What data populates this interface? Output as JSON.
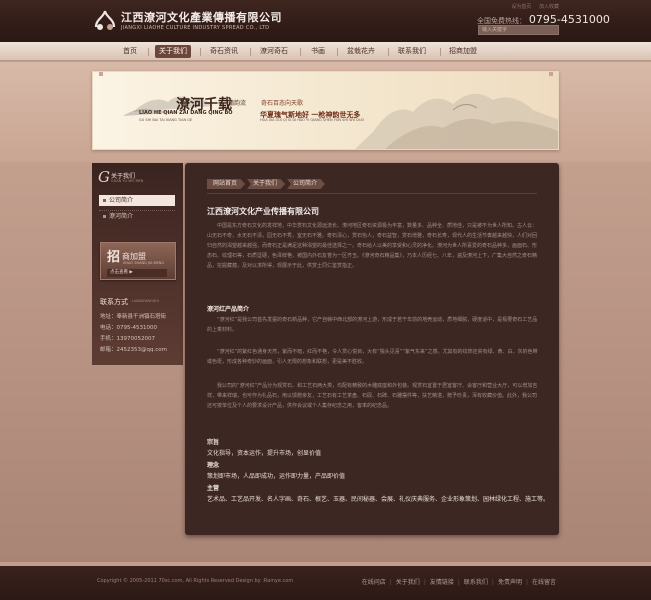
{
  "header": {
    "company_cn": "江西潦河文化產業傳播有限公司",
    "company_en": "JIANGXI LIAOHE CULTURE INDUSTRY SPREAD CO., LTD",
    "top_links": [
      "设为首页",
      "加入收藏"
    ],
    "hotline_label": "全国免费热线：",
    "hotline_number": "0795-4531000",
    "search_placeholder": "输入关键字"
  },
  "nav": {
    "items": [
      "首页",
      "关于我们",
      "奇石资讯",
      "潦河奇石",
      "书画",
      "盆栽花卉",
      "联系我们",
      "招商加盟"
    ],
    "active_index": 1
  },
  "banner": {
    "title": "潦河千载",
    "subtitle_a": "蒲韵流",
    "subtitle_b": "奇石百态向天歌",
    "pinyin_a": "LIAO HE QIAN ZAI DANG QING BO",
    "pinyin_b": "GU SHI BAI TAI XIANG TIAN GE",
    "slogan": "华夏瑰气斯地好 一枪神韵世无多",
    "pinyin_c": "HUA XIA GUI QI SI DI HAO  YI QIANG SHEN YUN SHI WU DUO"
  },
  "sidebar": {
    "head_initial": "G",
    "head_cn": "关于我们",
    "head_en": "GUAN YU WO MEN",
    "items": [
      "公司简介",
      "潦河简介"
    ],
    "active_index": 0,
    "join": {
      "big": "招",
      "rest": "商加盟",
      "en": "ZHAO SHANG JIA MENG",
      "button": "点击查看 ▶"
    },
    "contact": {
      "title": "联系方式",
      "title_en": "LIANXIFANGSHI",
      "lines": [
        "地址：奉新县千洲镇石塔街",
        "电话：0795-4531000",
        "手机：13970052007",
        "邮箱：2452353@qq.com"
      ]
    }
  },
  "content": {
    "breadcrumb": [
      "网站首页",
      "关于我们",
      "公司简介"
    ],
    "title": "江西潦河文化产业传播有限公司",
    "paragraph1": "中国是东方奇石文化的发祥地，中华赏石文化源远流长。潦河地区奇石资源极为丰富，数量多、品种全、质地佳，只是被不为世人所知。古人云：山无石不奇，水无石不清，园无石不秀，室无石不雅。奇石清心，赏石怡人，奇石益智，赏石增雅，奇石长寿，现代人的生活节奏越来越快，人们对回归自然的渴望越来越强，而奇石正是满足这种渴望的最佳选择之一。奇石给人以美的享受和心灵的净化。潦河为世人所喜爱的奇石品种多，画面石、形态石、纹理石等，石质坚硬，色泽鲜艳，被国内外石友誉为一区齐玉。《潦河奇石精品集》，乃本人历经七、八年，遍及潦河上下，广集大自然之奇石精品，挖掘藏蕴，及对以求所得，现展示于此，供赏士同仁鉴赏指正。",
    "section1_heading": "潦河红产品简介",
    "paragraph2": "“潦河红”是我公司首先发掘的奇石新品种，它产自赣中西北部的潦河上游，形成于若干年前的地壳运动，质地细腻，硬度适中，是极要奇石工艺品的上乘材料。",
    "paragraph3": "“潦河红”的紫红色通身天然，紫而不暗，红而不艳，令人赏心悦目，大有“独头见喜”“紫气东来”之感。尤其有的纹饰还夹有绿、黄、白、灰的色带或色斑，形成各种奇妙的画面，引人无限的想象和联想，更是美不胜收。",
    "paragraph4": "我公司的“潦河红”产品分为观赏石、和工艺石两大类，均配有精致的木雕底座和外包装。观赏石宜置于居室客厅、会客厅和营业大厅，可以增加吉祥，带来祥瑞，也可作为礼品石，用以馈赠亲友，工艺石有工艺茶盘、石砚、石碑、石雕摆件等，扶艺精湛，赠予珍贵，浑有收藏价值。此外，我公司还可按单位及个人的要求设计产品，供作会议或个人集存纪念之用，客率的纪念品。",
    "sections": [
      {
        "heading": "宗旨",
        "text": "文化指导，资本运作，提升市场，创显价值"
      },
      {
        "heading": "理念",
        "text": "策划即市场，人品即成功，运作即力量，产品即价值"
      },
      {
        "heading": "主营",
        "text": "艺术品、工艺品开发、名人字画、奇石、根艺、玉器、民间秘器、会展、礼仪庆典服务、企业形象策划、园林绿化工程、施工等。"
      }
    ]
  },
  "footer": {
    "copyright": "Copyright © 2005-2011 70sc.com, All Rights Reserved  Design by :Rainye.com",
    "links": [
      "在线问店",
      "关于我们",
      "友情链接",
      "联系我们",
      "免责声明",
      "在线留言"
    ]
  },
  "colors": {
    "header_bg": "#2f1b17",
    "content_bg": "#3c2723",
    "accent": "#6b463b",
    "page_bg": "#c29d8c"
  }
}
